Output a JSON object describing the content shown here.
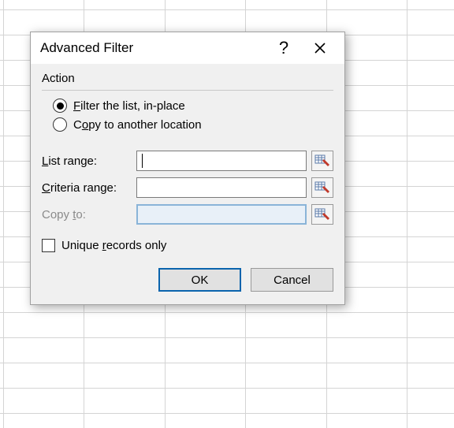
{
  "dialog": {
    "title": "Advanced Filter",
    "action_label": "Action",
    "radio_filter": "Filter the list, in-place",
    "radio_copy": "Copy to another location",
    "list_range_label": "List range:",
    "criteria_range_label": "Criteria range:",
    "copy_to_label": "Copy to:",
    "list_range_value": "",
    "criteria_range_value": "",
    "copy_to_value": "",
    "unique_label": "Unique records only",
    "ok_label": "OK",
    "cancel_label": "Cancel"
  }
}
